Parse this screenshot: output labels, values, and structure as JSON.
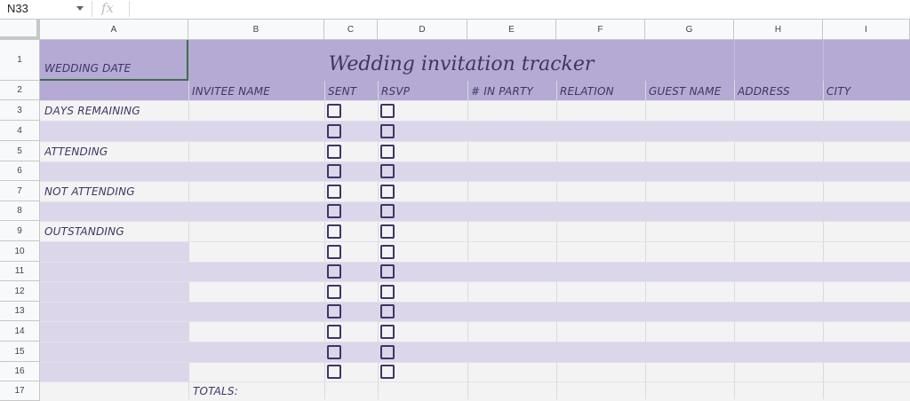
{
  "formula_bar": {
    "cell_ref": "N33",
    "fx_label": "fx",
    "formula": ""
  },
  "columns": [
    "A",
    "B",
    "C",
    "D",
    "E",
    "F",
    "G",
    "H",
    "I"
  ],
  "rows": [
    "1",
    "2",
    "3",
    "4",
    "5",
    "6",
    "7",
    "8",
    "9",
    "10",
    "11",
    "12",
    "13",
    "14",
    "15",
    "16",
    "17"
  ],
  "sheet": {
    "title": "Wedding invitation tracker",
    "wedding_date_label": "WEDDING DATE",
    "headers": {
      "invitee_name": "INVITEE NAME",
      "sent": "SENT",
      "rsvp": "RSVP",
      "in_party": "# IN PARTY",
      "relation": "RELATION",
      "guest_name": "GUEST NAME",
      "address": "ADDRESS",
      "city": "CITY"
    },
    "summary": {
      "days_remaining": "DAYS REMAINING",
      "attending": "ATTENDING",
      "not_attending": "NOT ATTENDING",
      "outstanding": "OUTSTANDING"
    },
    "totals_label": "TOTALS:"
  },
  "colors": {
    "header_purple": "#b4aad3",
    "light_row": "#f3f3f3",
    "purple_row": "#dcd6ea",
    "text": "#3f3566"
  }
}
